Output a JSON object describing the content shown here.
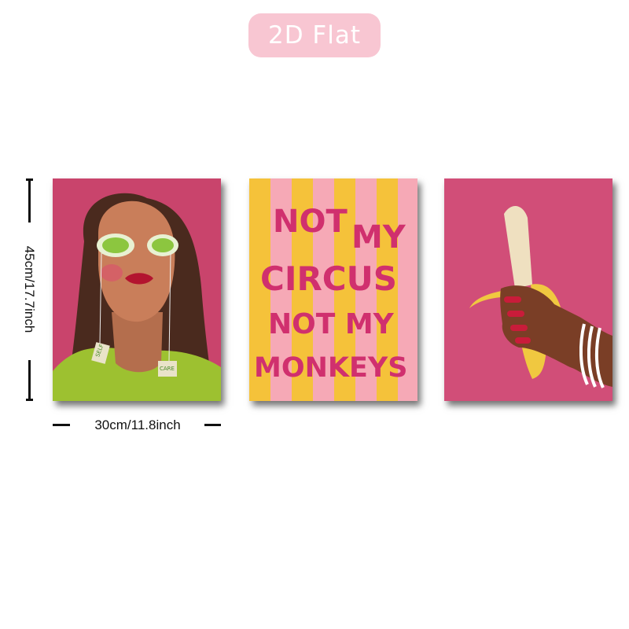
{
  "badge": {
    "label": "2D Flat"
  },
  "dimensions": {
    "height_label": "45cm/17.7inch",
    "width_label": "30cm/11.8inch"
  },
  "posters": [
    {
      "tag_left": "SELF",
      "tag_right": "CARE"
    },
    {
      "slogan_line1_a": "NOT",
      "slogan_line1_b": "MY",
      "slogan_line2": "CIRCUS",
      "slogan_line3": "NOT MY",
      "slogan_line4": "MONKEYS"
    },
    {}
  ],
  "colors": {
    "pink_bg": "#cf4770",
    "stripe_yellow": "#f5c23a",
    "stripe_pink": "#f6a9b6",
    "slogan": "#d0306e",
    "badge": "#f8c6d2"
  }
}
